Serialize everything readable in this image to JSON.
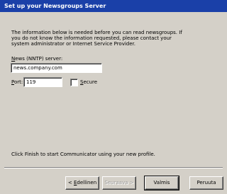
{
  "window": {
    "title": "Set up your Newsgroups Server"
  },
  "info": {
    "line1": "The information below is needed before you can read newsgroups.  If",
    "line2": "you do not know the information requested, please contact your",
    "line3": "system administrator or Internet Service Provider."
  },
  "server": {
    "label_accel": "N",
    "label_rest": "ews (NNTP) server:",
    "value": "news.company.com"
  },
  "port": {
    "label_accel": "P",
    "label_rest": "ort:",
    "value": "119"
  },
  "secure": {
    "label_accel": "S",
    "label_rest": "ecure",
    "checked": false
  },
  "finish_text": "Click Finish to start Communicator using your new profile.",
  "buttons": {
    "back_prefix": "< ",
    "back_accel": "E",
    "back_rest": "dellinen",
    "next_label": "Seuraava >",
    "finish_label": "Valmis",
    "cancel_label": "Peruuta"
  }
}
